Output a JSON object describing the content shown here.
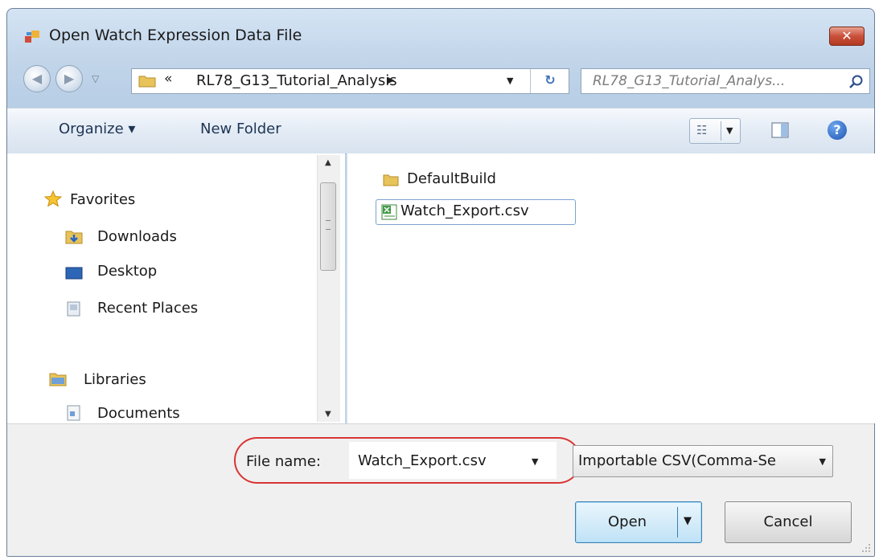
{
  "window": {
    "title": "Open Watch Expression Data File",
    "close_label": "✕"
  },
  "address": {
    "chevron": "«",
    "path": "RL78_G13_Tutorial_Analysis",
    "search_placeholder": "RL78_G13_Tutorial_Analys..."
  },
  "toolbar": {
    "organize": "Organize ▾",
    "new_folder": "New Folder"
  },
  "nav": {
    "favorites": "Favorites",
    "downloads": "Downloads",
    "desktop": "Desktop",
    "recent_places": "Recent Places",
    "libraries": "Libraries",
    "documents": "Documents"
  },
  "files": [
    {
      "name": "DefaultBuild",
      "type": "folder"
    },
    {
      "name": "Watch_Export.csv",
      "type": "csv",
      "selected": true
    }
  ],
  "bottom": {
    "file_name_label": "File name:",
    "file_name_value": "Watch_Export.csv",
    "file_type": "Importable CSV(Comma-Se",
    "open": "Open",
    "cancel": "Cancel"
  },
  "colors": {
    "highlight": "#d93434",
    "accent": "#3c7fb1"
  }
}
